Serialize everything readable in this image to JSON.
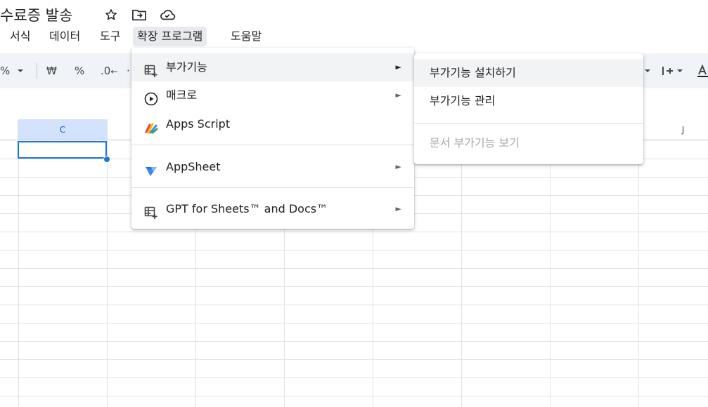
{
  "app": {
    "doc_title": "수료증 발송",
    "title_icons": [
      "star-icon",
      "move-folder-icon",
      "cloud-saved-icon"
    ]
  },
  "menubar": {
    "items": [
      {
        "label": "서식"
      },
      {
        "label": "데이터"
      },
      {
        "label": "도구"
      },
      {
        "label": "확장 프로그램",
        "active": true
      },
      {
        "label": "도움말"
      }
    ]
  },
  "toolbar": {
    "percent_left": "%",
    "currency": "₩",
    "percent": "%",
    "decimal_decrease": ".0",
    "more_dot": "·"
  },
  "sheet": {
    "columns": [
      {
        "label": "C",
        "selected": true
      },
      {
        "label": "",
        "selected": false
      },
      {
        "label": "",
        "selected": false
      },
      {
        "label": "",
        "selected": false
      },
      {
        "label": "",
        "selected": false
      },
      {
        "label": "",
        "selected": false
      },
      {
        "label": "",
        "selected": false
      },
      {
        "label": "J",
        "selected": false
      }
    ]
  },
  "extensions_menu": {
    "items": [
      {
        "label": "부가기능",
        "icon": "addons-grid-icon",
        "submenu": true,
        "hover": true
      },
      {
        "label": "매크로",
        "icon": "play-circle-icon",
        "submenu": true
      },
      {
        "label": "Apps Script",
        "icon": "apps-script-icon",
        "submenu": false
      },
      {
        "label": "AppSheet",
        "icon": "appsheet-icon",
        "submenu": true
      },
      {
        "label": "GPT for Sheets™ and Docs™",
        "icon": "addon-grid-icon",
        "submenu": true
      }
    ],
    "submenu_arrow": "►"
  },
  "addons_submenu": {
    "items": [
      {
        "label": "부가기능 설치하기",
        "hover": true,
        "disabled": false
      },
      {
        "label": "부가기능 관리",
        "disabled": false
      },
      {
        "label": "문서 부가기능 보기",
        "disabled": true
      }
    ]
  },
  "colors": {
    "selection_blue": "#1a73e8",
    "selected_header_bg": "#d3e3fd",
    "toolbar_bg": "#f0f4f9",
    "menu_hover": "#f1f3f4"
  }
}
